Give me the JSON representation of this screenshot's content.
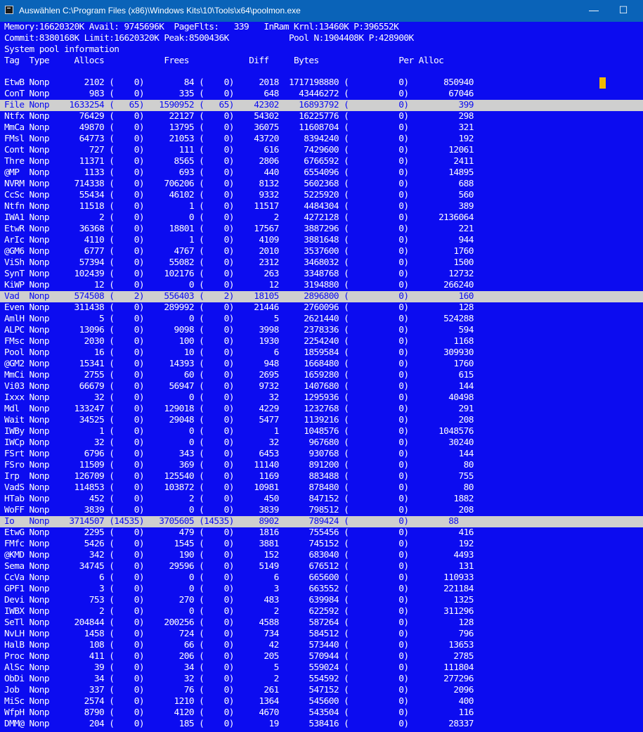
{
  "window": {
    "title": "Auswählen C:\\Program Files (x86)\\Windows Kits\\10\\Tools\\x64\\poolmon.exe",
    "minimize": "—",
    "maximize": "☐",
    "close": "✕"
  },
  "header": {
    "line1": "Memory:16620320K Avail: 9745696K  PageFlts:   339   InRam Krnl:13460K P:396552K",
    "line2": "Commit:8380168K Limit:16620320K Peak:8500436K            Pool N:1904408K P:428900K",
    "line3": "System pool information",
    "line4": "Tag  Type     Allocs            Frees            Diff     Bytes                Per Alloc"
  },
  "rows": [
    {
      "text": "EtwB Nonp       2102 (    0)        84 (    0)     2018  1717198880 (          0)       850940",
      "hl": false
    },
    {
      "text": "ConT Nonp        983 (    0)       335 (    0)      648    43446272 (          0)        67046",
      "hl": false
    },
    {
      "text": "File Nonp    1633254 (   65)   1590952 (   65)    42302    16893792 (          0)          399",
      "hl": true
    },
    {
      "text": "Ntfx Nonp      76429 (    0)     22127 (    0)    54302    16225776 (          0)          298",
      "hl": false
    },
    {
      "text": "MmCa Nonp      49870 (    0)     13795 (    0)    36075    11608704 (          0)          321",
      "hl": false
    },
    {
      "text": "FMsl Nonp      64773 (    0)     21053 (    0)    43720     8394240 (          0)          192",
      "hl": false
    },
    {
      "text": "Cont Nonp        727 (    0)       111 (    0)      616     7429600 (          0)        12061",
      "hl": false
    },
    {
      "text": "Thre Nonp      11371 (    0)      8565 (    0)     2806     6766592 (          0)         2411",
      "hl": false
    },
    {
      "text": "@MP  Nonp       1133 (    0)       693 (    0)      440     6554096 (          0)        14895",
      "hl": false
    },
    {
      "text": "NVRM Nonp     714338 (    0)    706206 (    0)     8132     5602368 (          0)          688",
      "hl": false
    },
    {
      "text": "CcSc Nonp      55434 (    0)     46102 (    0)     9332     5225920 (          0)          560",
      "hl": false
    },
    {
      "text": "Ntfn Nonp      11518 (    0)         1 (    0)    11517     4484304 (          0)          389",
      "hl": false
    },
    {
      "text": "IWA1 Nonp          2 (    0)         0 (    0)        2     4272128 (          0)      2136064",
      "hl": false
    },
    {
      "text": "EtwR Nonp      36368 (    0)     18801 (    0)    17567     3887296 (          0)          221",
      "hl": false
    },
    {
      "text": "ArIc Nonp       4110 (    0)         1 (    0)     4109     3881648 (          0)          944",
      "hl": false
    },
    {
      "text": "@GM6 Nonp       6777 (    0)      4767 (    0)     2010     3537600 (          0)         1760",
      "hl": false
    },
    {
      "text": "ViSh Nonp      57394 (    0)     55082 (    0)     2312     3468032 (          0)         1500",
      "hl": false
    },
    {
      "text": "SynT Nonp     102439 (    0)    102176 (    0)      263     3348768 (          0)        12732",
      "hl": false
    },
    {
      "text": "KiWP Nonp         12 (    0)         0 (    0)       12     3194880 (          0)       266240",
      "hl": false
    },
    {
      "text": "Vad  Nonp     574508 (    2)    556403 (    2)    18105     2896800 (          0)          160",
      "hl": true
    },
    {
      "text": "Even Nonp     311438 (    0)    289992 (    0)    21446     2760096 (          0)          128",
      "hl": false
    },
    {
      "text": "AmlH Nonp          5 (    0)         0 (    0)        5     2621440 (          0)       524288",
      "hl": false
    },
    {
      "text": "ALPC Nonp      13096 (    0)      9098 (    0)     3998     2378336 (          0)          594",
      "hl": false
    },
    {
      "text": "FMsc Nonp       2030 (    0)       100 (    0)     1930     2254240 (          0)         1168",
      "hl": false
    },
    {
      "text": "Pool Nonp         16 (    0)        10 (    0)        6     1859584 (          0)       309930",
      "hl": false
    },
    {
      "text": "@GM2 Nonp      15341 (    0)     14393 (    0)      948     1668480 (          0)         1760",
      "hl": false
    },
    {
      "text": "MmCi Nonp       2755 (    0)        60 (    0)     2695     1659280 (          0)          615",
      "hl": false
    },
    {
      "text": "Vi03 Nonp      66679 (    0)     56947 (    0)     9732     1407680 (          0)          144",
      "hl": false
    },
    {
      "text": "Ixxx Nonp         32 (    0)         0 (    0)       32     1295936 (          0)        40498",
      "hl": false
    },
    {
      "text": "Mdl  Nonp     133247 (    0)    129018 (    0)     4229     1232768 (          0)          291",
      "hl": false
    },
    {
      "text": "Wait Nonp      34525 (    0)     29048 (    0)     5477     1139216 (          0)          208",
      "hl": false
    },
    {
      "text": "IWBy Nonp          1 (    0)         0 (    0)        1     1048576 (          0)      1048576",
      "hl": false
    },
    {
      "text": "IWCp Nonp         32 (    0)         0 (    0)       32      967680 (          0)        30240",
      "hl": false
    },
    {
      "text": "FSrt Nonp       6796 (    0)       343 (    0)     6453      930768 (          0)          144",
      "hl": false
    },
    {
      "text": "FSro Nonp      11509 (    0)       369 (    0)    11140      891200 (          0)           80",
      "hl": false
    },
    {
      "text": "Irp  Nonp     126709 (    0)    125540 (    0)     1169      883488 (          0)          755",
      "hl": false
    },
    {
      "text": "VadS Nonp     114853 (    0)    103872 (    0)    10981      878480 (          0)           80",
      "hl": false
    },
    {
      "text": "HTab Nonp        452 (    0)         2 (    0)      450      847152 (          0)         1882",
      "hl": false
    },
    {
      "text": "WoFF Nonp       3839 (    0)         0 (    0)     3839      798512 (          0)          208",
      "hl": false
    },
    {
      "text": "Io   Nonp    3714507 (14535)   3705605 (14535)     8902      789424 (          0)        88",
      "hl": true
    },
    {
      "text": "EtwG Nonp       2295 (    0)       479 (    0)     1816      755456 (          0)          416",
      "hl": false
    },
    {
      "text": "FMfc Nonp       5426 (    0)      1545 (    0)     3881      745152 (          0)          192",
      "hl": false
    },
    {
      "text": "@KMD Nonp        342 (    0)       190 (    0)      152      683040 (          0)         4493",
      "hl": false
    },
    {
      "text": "Sema Nonp      34745 (    0)     29596 (    0)     5149      676512 (          0)          131",
      "hl": false
    },
    {
      "text": "CcVa Nonp          6 (    0)         0 (    0)        6      665600 (          0)       110933",
      "hl": false
    },
    {
      "text": "GPF1 Nonp          3 (    0)         0 (    0)        3      663552 (          0)       221184",
      "hl": false
    },
    {
      "text": "Devi Nonp        753 (    0)       270 (    0)      483      639984 (          0)         1325",
      "hl": false
    },
    {
      "text": "IWBX Nonp          2 (    0)         0 (    0)        2      622592 (          0)       311296",
      "hl": false
    },
    {
      "text": "SeTl Nonp     204844 (    0)    200256 (    0)     4588      587264 (          0)          128",
      "hl": false
    },
    {
      "text": "NvLH Nonp       1458 (    0)       724 (    0)      734      584512 (          0)          796",
      "hl": false
    },
    {
      "text": "HalB Nonp        108 (    0)        66 (    0)       42      573440 (          0)        13653",
      "hl": false
    },
    {
      "text": "Proc Nonp        411 (    0)       206 (    0)      205      570944 (          0)         2785",
      "hl": false
    },
    {
      "text": "AlSc Nonp         39 (    0)        34 (    0)        5      559024 (          0)       111804",
      "hl": false
    },
    {
      "text": "ObDi Nonp         34 (    0)        32 (    0)        2      554592 (          0)       277296",
      "hl": false
    },
    {
      "text": "Job  Nonp        337 (    0)        76 (    0)      261      547152 (          0)         2096",
      "hl": false
    },
    {
      "text": "MiSc Nonp       2574 (    0)      1210 (    0)     1364      545600 (          0)          400",
      "hl": false
    },
    {
      "text": "WfpH Nonp       8790 (    0)      4120 (    0)     4670      543504 (          0)          116",
      "hl": false
    },
    {
      "text": "DMM@ Nonp        204 (    0)       185 (    0)       19      538416 (          0)        28337",
      "hl": false
    }
  ],
  "colors": {
    "background": "#0c0cf0",
    "text": "#ffffff",
    "highlight": "#cfcfcf",
    "cursor": "#f0b800",
    "titlebar": "#0a63b8"
  }
}
